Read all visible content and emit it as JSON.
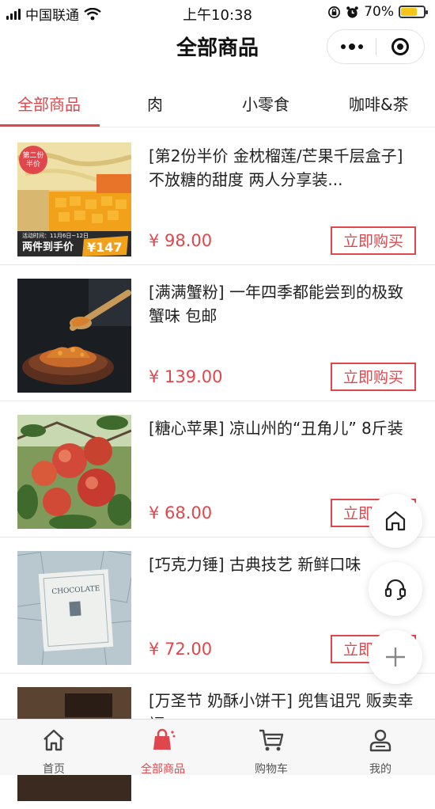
{
  "status_bar": {
    "carrier": "中国联通",
    "time": "上午10:38",
    "battery": "70%",
    "battery_level": 0.7
  },
  "nav": {
    "title": "全部商品",
    "menu_icon": "more-dots-icon",
    "close_icon": "target-circle-icon"
  },
  "tabs": [
    {
      "label": "全部商品",
      "active": true
    },
    {
      "label": "肉",
      "active": false
    },
    {
      "label": "小零食",
      "active": false
    },
    {
      "label": "咖啡&茶",
      "active": false
    }
  ],
  "products": [
    {
      "title": "[第2份半价 金枕榴莲/芒果千层盒子]  不放糖的甜度 两人分享装...",
      "price": "¥ 98.00",
      "buy_label": "立即购买",
      "image": {
        "badge": "第二份半价",
        "event_text": "活动时间：11月6日~12日",
        "promo_text": "两件到手价",
        "promo_price": "¥147"
      }
    },
    {
      "title": "[满满蟹粉] 一年四季都能尝到的极致蟹味 包邮",
      "price": "¥ 139.00",
      "buy_label": "立即购买",
      "image": {}
    },
    {
      "title": "[糖心苹果] 凉山州的“丑角儿” 8斤装",
      "price": "¥ 68.00",
      "buy_label": "立即购买",
      "image": {}
    },
    {
      "title": "[巧克力锤] 古典技艺 新鲜口味",
      "price": "¥ 72.00",
      "buy_label": "立即购买",
      "image": {
        "box_text": "CHOCOLATE"
      }
    },
    {
      "title": "[万圣节 奶酥小饼干]  兜售诅咒 贩卖幸福",
      "price": "",
      "buy_label": "",
      "image": {}
    }
  ],
  "floating": {
    "home_icon": "home-outline-icon",
    "service_icon": "headset-icon",
    "add_icon": "plus-icon"
  },
  "tabbar": [
    {
      "label": "首页",
      "icon": "home-icon",
      "active": false
    },
    {
      "label": "全部商品",
      "icon": "shopping-bag-icon",
      "active": true
    },
    {
      "label": "购物车",
      "icon": "cart-icon",
      "active": false
    },
    {
      "label": "我的",
      "icon": "user-icon",
      "active": false
    }
  ],
  "colors": {
    "accent": "#e0474c"
  }
}
